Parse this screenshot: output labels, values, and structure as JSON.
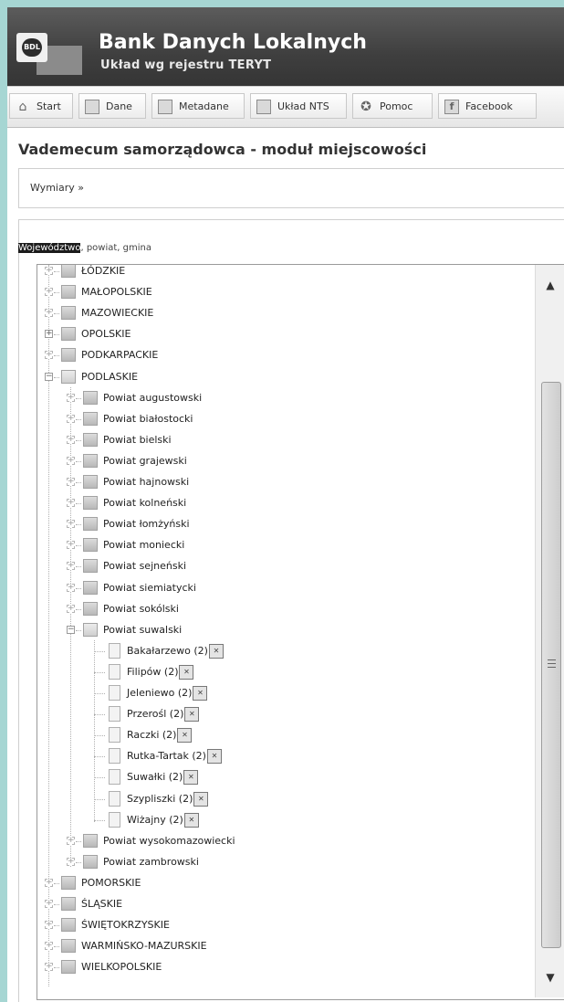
{
  "header": {
    "logo_text": "BDL",
    "title": "Bank Danych Lokalnych",
    "subtitle": "Układ wg rejestru TERYT"
  },
  "toolbar": [
    {
      "label": "Start",
      "icon": "house-icon"
    },
    {
      "label": "Dane",
      "icon": "data-icon"
    },
    {
      "label": "Metadane",
      "icon": "metadata-icon"
    },
    {
      "label": "Układ NTS",
      "icon": "nts-icon"
    },
    {
      "label": "Pomoc",
      "icon": "help-icon"
    },
    {
      "label": "Facebook",
      "icon": "facebook-icon"
    }
  ],
  "page_title": "Vademecum samorządowca - moduł miejscowości",
  "breadcrumb": "Wymiary »",
  "panel_label": {
    "highlight": "Województwo",
    "rest": ", powiat, gmina"
  },
  "tree": {
    "voivodeships_top": [
      "ŁÓDZKIE",
      "MAŁOPOLSKIE",
      "MAZOWIECKIE",
      "OPOLSKIE",
      "PODKARPACKIE"
    ],
    "expanded_voivodeship": "PODLASKIE",
    "powiats_before": [
      "Powiat augustowski",
      "Powiat białostocki",
      "Powiat bielski",
      "Powiat grajewski",
      "Powiat hajnowski",
      "Powiat kolneński",
      "Powiat łomżyński",
      "Powiat moniecki",
      "Powiat sejneński",
      "Powiat siemiatycki",
      "Powiat sokólski"
    ],
    "expanded_powiat": "Powiat suwalski",
    "gminas": [
      "Bakałarzewo (2)",
      "Filipów (2)",
      "Jeleniewo (2)",
      "Przerośl (2)",
      "Raczki (2)",
      "Rutka-Tartak (2)",
      "Suwałki (2)",
      "Szypliszki (2)",
      "Wiżajny (2)"
    ],
    "powiats_after": [
      "Powiat wysokomazowiecki",
      "Powiat zambrowski"
    ],
    "voivodeships_bottom": [
      "POMORSKIE",
      "ŚLĄSKIE",
      "ŚWIĘTOKRZYSKIE",
      "WARMIŃSKO-MAZURSKIE",
      "WIELKOPOLSKIE"
    ]
  },
  "scroll": {
    "up": "▲",
    "down": "▼"
  }
}
